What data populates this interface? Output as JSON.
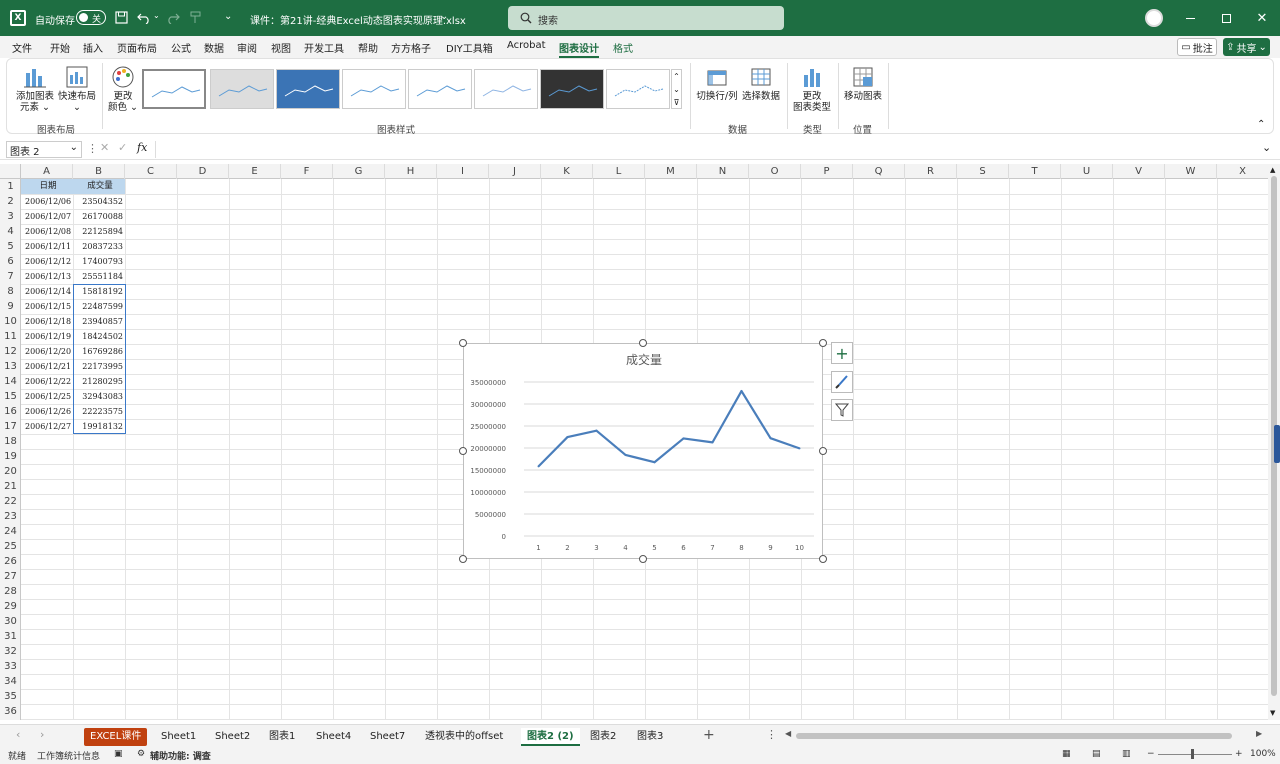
{
  "titlebar": {
    "autosave_label": "自动保存",
    "autosave_state": "关",
    "file_title": "课件：第21讲-经典Excel动态图表实现原理.xlsx",
    "search_placeholder": "搜索"
  },
  "menu": {
    "items": [
      "文件",
      "开始",
      "插入",
      "页面布局",
      "公式",
      "数据",
      "审阅",
      "视图",
      "开发工具",
      "帮助",
      "方方格子",
      "DIY工具箱",
      "Acrobat",
      "图表设计",
      "格式"
    ],
    "active_index": 13,
    "comment_label": "批注",
    "share_label": "共享"
  },
  "ribbon": {
    "add_element_label1": "添加图表",
    "add_element_label2": "元素",
    "quick_layout_label": "快速布局",
    "change_color_label1": "更改",
    "change_color_label2": "颜色",
    "group_layout": "图表布局",
    "group_styles": "图表样式",
    "switch_rowcol_label": "切换行/列",
    "select_data_label": "选择数据",
    "group_data": "数据",
    "change_type_label1": "更改",
    "change_type_label2": "图表类型",
    "group_type": "类型",
    "move_chart_label": "移动图表",
    "group_location": "位置"
  },
  "formula_bar": {
    "name_box": "图表 2",
    "fx": "fx",
    "content": ""
  },
  "columns": [
    "A",
    "B",
    "C",
    "D",
    "E",
    "F",
    "G",
    "H",
    "I",
    "J",
    "K",
    "L",
    "M",
    "N",
    "O",
    "P",
    "Q",
    "R",
    "S",
    "T",
    "U",
    "V",
    "W",
    "X"
  ],
  "rows": [
    "1",
    "2",
    "3",
    "4",
    "5",
    "6",
    "7",
    "8",
    "9",
    "10",
    "11",
    "12",
    "13",
    "14",
    "15",
    "16",
    "17",
    "18",
    "19",
    "20",
    "21",
    "22",
    "23",
    "24",
    "25",
    "26",
    "27",
    "28",
    "29",
    "30",
    "31",
    "32",
    "33",
    "34",
    "35",
    "36"
  ],
  "table": {
    "header_a": "日期",
    "header_b": "成交量",
    "dates": [
      "2006/12/06",
      "2006/12/07",
      "2006/12/08",
      "2006/12/11",
      "2006/12/12",
      "2006/12/13",
      "2006/12/14",
      "2006/12/15",
      "2006/12/18",
      "2006/12/19",
      "2006/12/20",
      "2006/12/21",
      "2006/12/22",
      "2006/12/25",
      "2006/12/26",
      "2006/12/27"
    ],
    "volumes": [
      "23504352",
      "26170088",
      "22125894",
      "20837233",
      "17400793",
      "25551184",
      "15818192",
      "22487599",
      "23940857",
      "18424502",
      "16769286",
      "22173995",
      "21280295",
      "32943083",
      "22223575",
      "19918132"
    ]
  },
  "chart_data": {
    "type": "line",
    "title": "成交量",
    "categories": [
      "1",
      "2",
      "3",
      "4",
      "5",
      "6",
      "7",
      "8",
      "9",
      "10"
    ],
    "series": [
      {
        "name": "成交量",
        "values": [
          15818192,
          22487599,
          23940857,
          18424502,
          16769286,
          22173995,
          21280295,
          32943083,
          22223575,
          19918132
        ]
      }
    ],
    "yticks": [
      "35000000",
      "30000000",
      "25000000",
      "20000000",
      "15000000",
      "10000000",
      "5000000",
      "0"
    ],
    "ylim": [
      0,
      35000000
    ],
    "grid": true,
    "line_color": "#4a7ebb"
  },
  "sheets": {
    "tabs": [
      "EXCEL课件",
      "Sheet1",
      "Sheet2",
      "图表1",
      "Sheet4",
      "Sheet7",
      "透视表中的offset",
      "图表2 (2)",
      "图表2",
      "图表3"
    ],
    "active_index": 7,
    "colored_index": 0
  },
  "status": {
    "ready": "就绪",
    "stats": "工作簿统计信息",
    "accessibility": "辅助功能: 调查",
    "zoom": "100%"
  },
  "colors": {
    "brand": "#1e6e42",
    "selection": "#bdd7ee",
    "tab_accent": "#c0410f"
  }
}
